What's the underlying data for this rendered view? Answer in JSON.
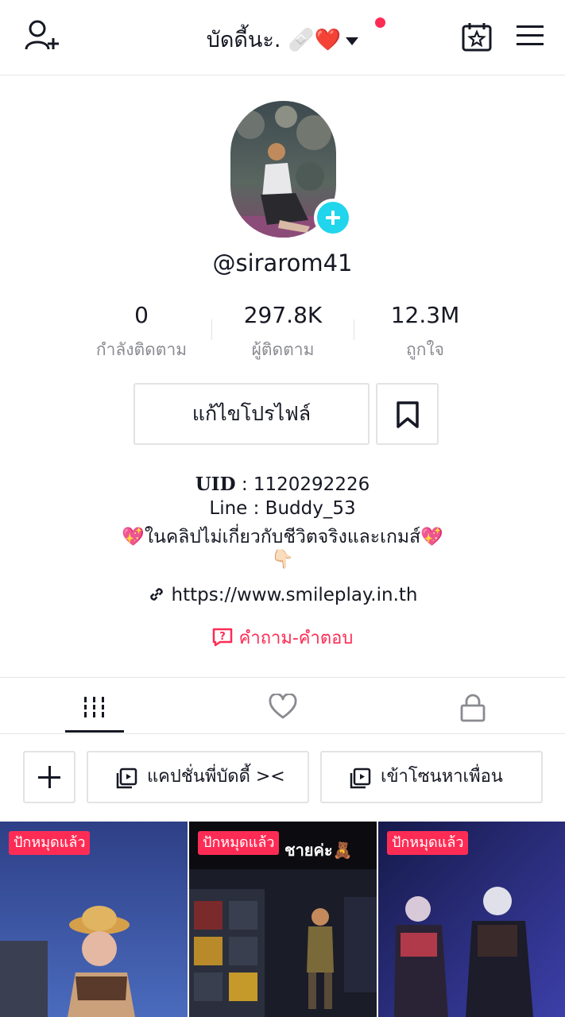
{
  "header": {
    "title": "บัดดี้นะ. 🩹❤️",
    "add_friend_icon": "person-plus-icon",
    "calendar_icon": "calendar-star-icon",
    "menu_icon": "hamburger-menu-icon",
    "notification_dot_color": "#fe2c55"
  },
  "profile": {
    "username": "@sirarom41",
    "avatar_add_color": "#20d5ec"
  },
  "stats": [
    {
      "value": "0",
      "label": "กำลังติดตาม"
    },
    {
      "value": "297.8K",
      "label": "ผู้ติดตาม"
    },
    {
      "value": "12.3M",
      "label": "ถูกใจ"
    }
  ],
  "actions": {
    "edit_profile": "แก้ไขโปรไฟล์",
    "bookmark_icon": "bookmark-icon"
  },
  "bio": {
    "uid_key": "UID",
    "uid_value": " : 1120292226",
    "line": "Line : Buddy_53",
    "desc": "💖ในคลิปไม่เกี่ยวกับชีวิตจริงและเกมส์💖",
    "pointer": "👇🏻",
    "link": "https://www.smileplay.in.th",
    "qa": "คำถาม-คำตอบ"
  },
  "tabs": [
    {
      "icon": "videos-grid-icon",
      "active": true
    },
    {
      "icon": "heart-icon",
      "active": false
    },
    {
      "icon": "lock-icon",
      "active": false
    }
  ],
  "playlists": [
    {
      "label": "แคปชั่นพี่บัดดี้ ><"
    },
    {
      "label": "เข้าโซนหาเพื่อน"
    }
  ],
  "videos": [
    {
      "badge": "ปักหมุดแล้ว",
      "overlay_text": ""
    },
    {
      "badge": "ปักหมุดแล้ว",
      "overlay_text": "ชายค่ะ🧸"
    },
    {
      "badge": "ปักหมุดแล้ว",
      "overlay_text": ""
    }
  ]
}
